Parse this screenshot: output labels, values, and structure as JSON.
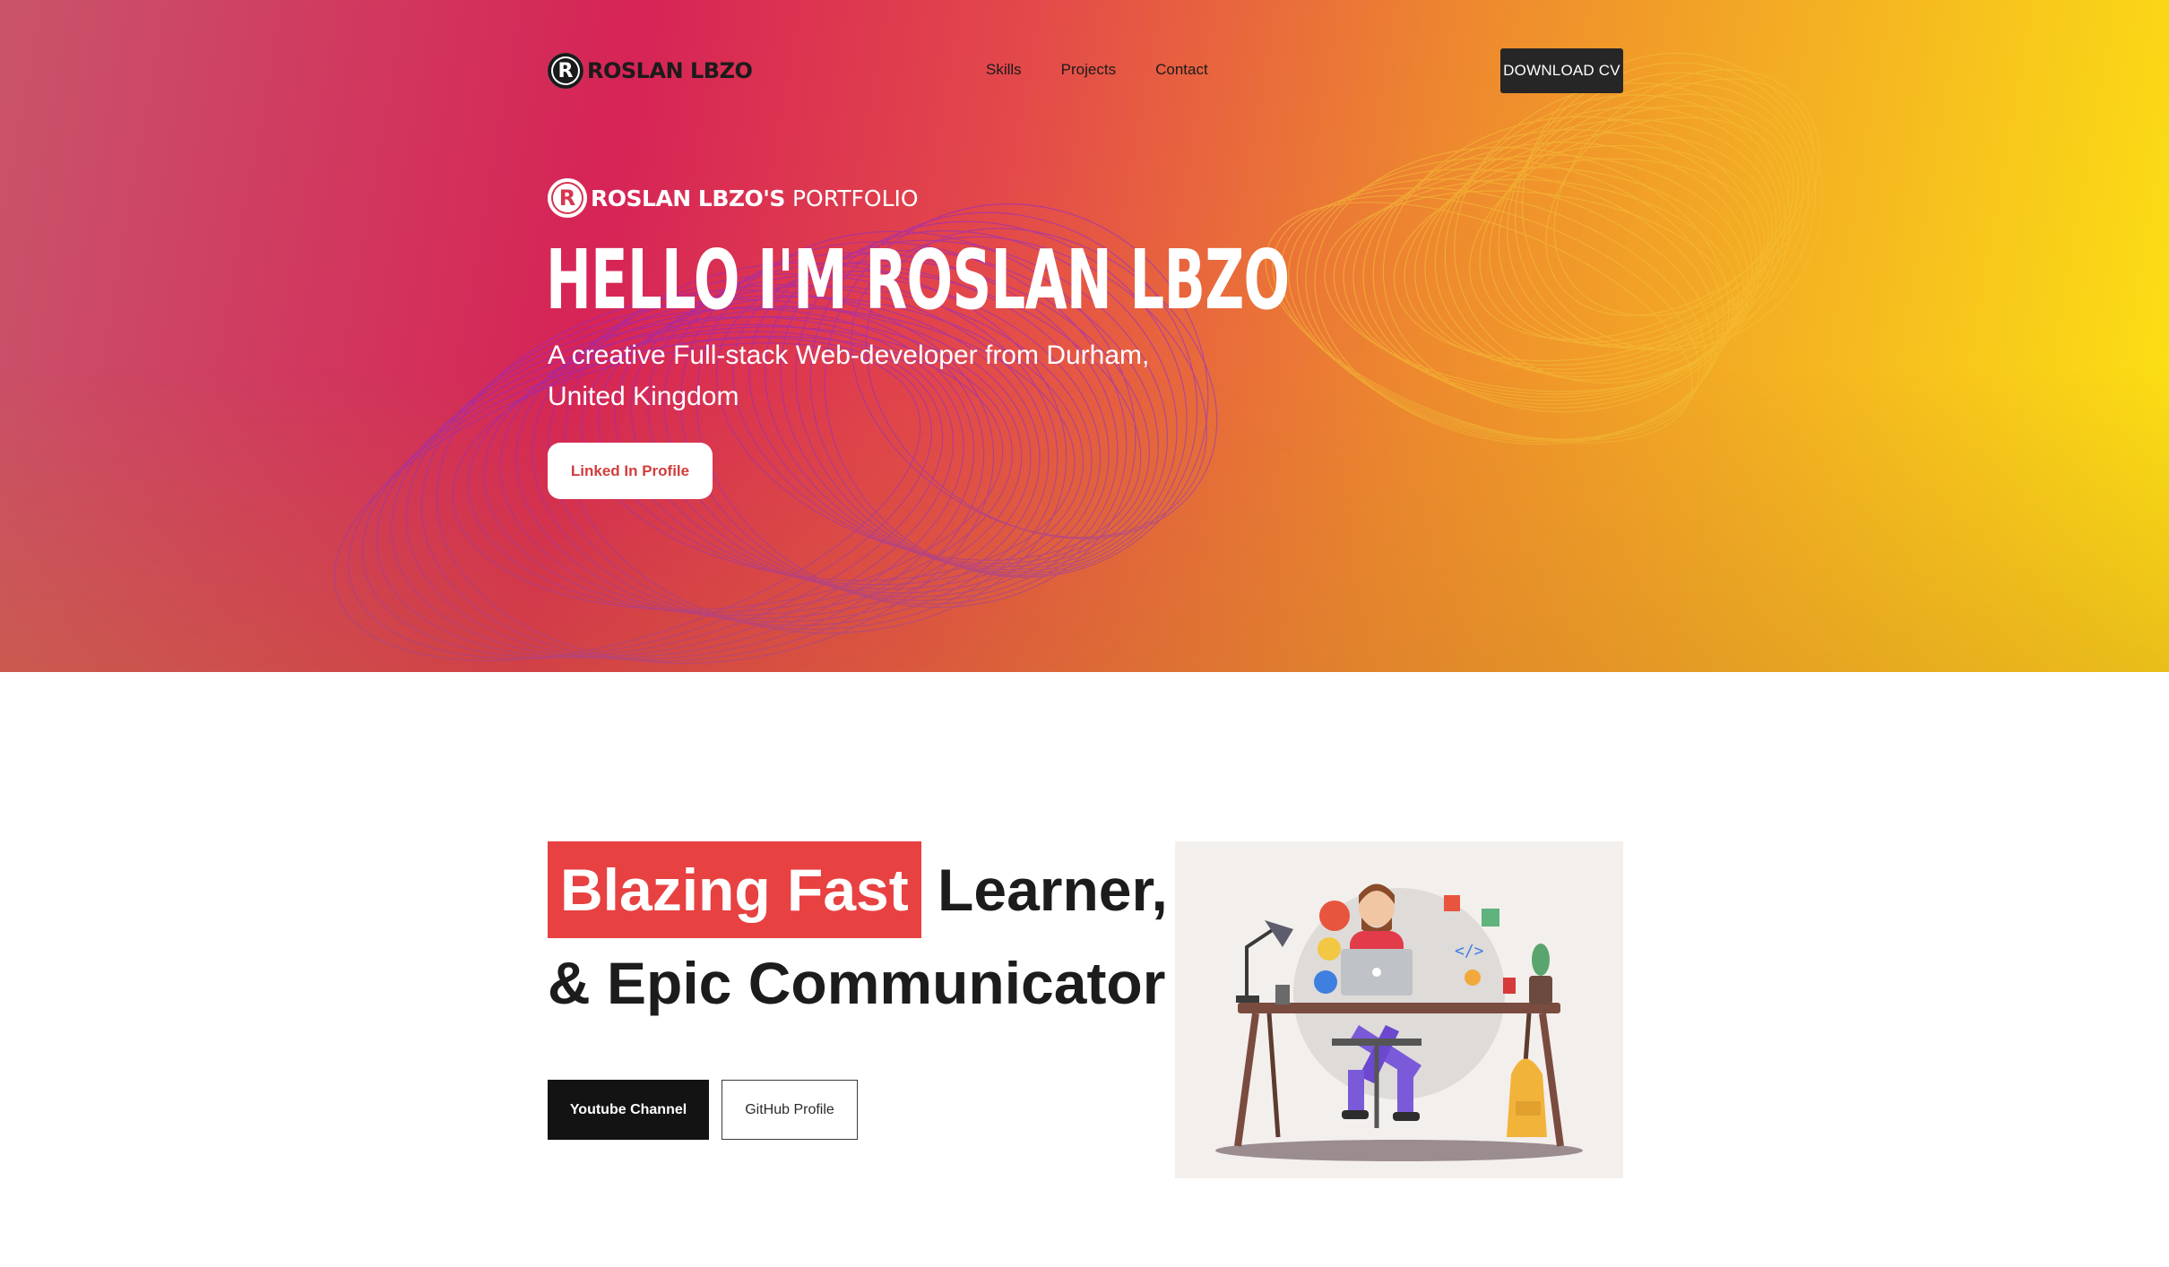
{
  "nav": {
    "logo_letter": "R",
    "logo_text": "ROSLAN LBZO",
    "links": [
      "Skills",
      "Projects",
      "Contact"
    ],
    "cta_label": "DOWNLOAD CV"
  },
  "hero": {
    "badge_letter": "R",
    "brand_bold": "ROSLAN LBZO'S",
    "brand_light": "PORTFOLIO",
    "title": "HELLO I'M ROSLAN LBZO",
    "subtitle": "A creative Full-stack Web-developer from Durham, United Kingdom",
    "button_label": "Linked In Profile"
  },
  "about": {
    "highlight": "Blazing Fast",
    "headline_rest": " Learner,",
    "headline_line2": "& Epic Communicator",
    "primary_button": "Youtube Channel",
    "secondary_button": "GitHub Profile"
  },
  "colors": {
    "accent": "#e84142",
    "dark": "#131313",
    "gradient_pink": "#d62456",
    "gradient_yellow": "#fce412"
  }
}
